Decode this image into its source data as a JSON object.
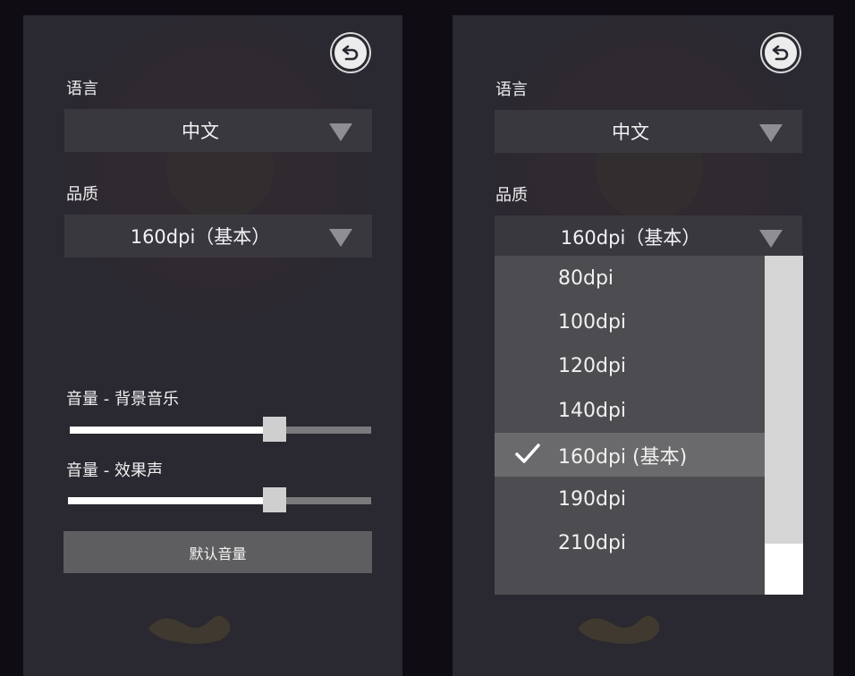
{
  "left_panel": {
    "language": {
      "label": "语言",
      "value": "中文"
    },
    "quality": {
      "label": "品质",
      "value": "160dpi（基本）"
    },
    "volume_bgm": {
      "label": "音量 - 背景音乐",
      "level": 0.68
    },
    "volume_sfx": {
      "label": "音量 - 效果声",
      "level": 0.68
    },
    "reset_button": "默认音量"
  },
  "right_panel": {
    "language": {
      "label": "语言",
      "value": "中文"
    },
    "quality": {
      "label": "品质",
      "value": "160dpi（基本）"
    },
    "dpi_options": [
      "80dpi",
      "100dpi",
      "120dpi",
      "140dpi",
      "160dpi (基本)",
      "190dpi",
      "210dpi"
    ],
    "selected_option": "160dpi (基本)"
  },
  "icons": {
    "back": "back-arrow-icon",
    "dropdown": "triangle-down-icon",
    "selected": "checkmark-icon"
  }
}
